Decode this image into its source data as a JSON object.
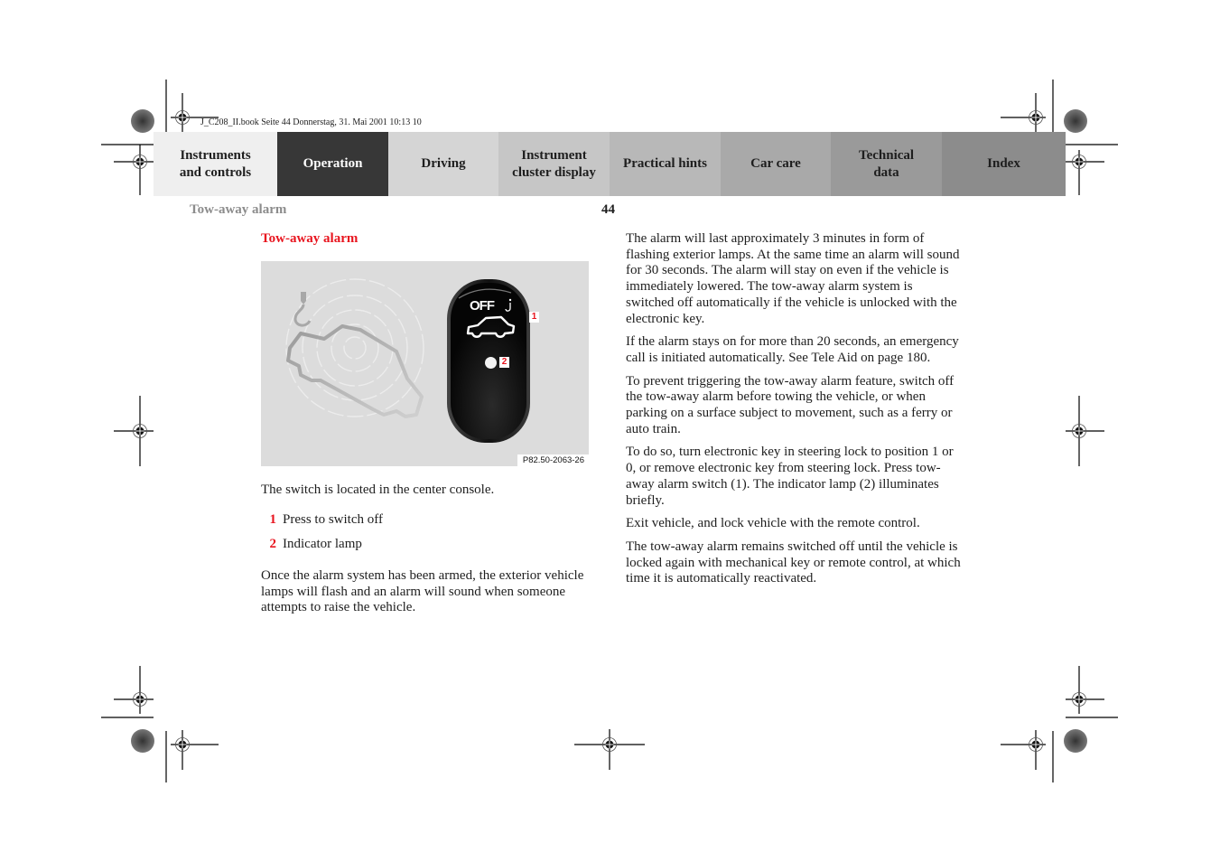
{
  "print_slug": "J_C208_II.book  Seite 44  Donnerstag, 31. Mai 2001  10:13 10",
  "nav": {
    "tabs": [
      {
        "label_line1": "Instruments",
        "label_line2": "and controls",
        "bg": "#efefef",
        "active": false
      },
      {
        "label_line1": "Operation",
        "label_line2": "",
        "bg": "#373737",
        "active": true
      },
      {
        "label_line1": "Driving",
        "label_line2": "",
        "bg": "#d5d5d5",
        "active": false
      },
      {
        "label_line1": "Instrument",
        "label_line2": "cluster display",
        "bg": "#c6c6c6",
        "active": false
      },
      {
        "label_line1": "Practical hints",
        "label_line2": "",
        "bg": "#b8b8b8",
        "active": false
      },
      {
        "label_line1": "Car care",
        "label_line2": "",
        "bg": "#a9a9a9",
        "active": false
      },
      {
        "label_line1": "Technical",
        "label_line2": "data",
        "bg": "#9a9a9a",
        "active": false
      },
      {
        "label_line1": "Index",
        "label_line2": "",
        "bg": "#8c8c8c",
        "active": false
      }
    ]
  },
  "running_header": {
    "title": "Tow-away alarm",
    "page_number": "44"
  },
  "section": {
    "title": "Tow-away alarm",
    "figure": {
      "code": "P82.50-2063-26",
      "switch_label": "OFF",
      "callouts": [
        "1",
        "2"
      ]
    },
    "intro": "The switch is located in the center console.",
    "legend": [
      {
        "num": "1",
        "text": "Press to switch off"
      },
      {
        "num": "2",
        "text": "Indicator lamp"
      }
    ],
    "left_paragraph": "Once the alarm system has been armed, the exterior vehicle lamps will flash and an alarm will sound when someone attempts to raise the vehicle.",
    "right_paragraphs": [
      "The alarm will last approximately 3 minutes in form of flashing exterior lamps. At the same time an alarm will sound for 30 seconds. The alarm will stay on even if the vehicle is immediately lowered. The tow-away alarm system is switched off automatically if the vehicle is unlocked with the electronic key.",
      "If the alarm stays on for more than 20 seconds, an emergency call is initiated automatically. See Tele Aid on page 180.",
      "To prevent triggering the tow-away alarm feature, switch off the tow-away alarm before towing the vehicle, or when parking on a surface subject to movement, such as a ferry or auto train.",
      "To do so, turn electronic key in steering lock to position 1 or 0, or remove electronic key from steering lock. Press tow-away alarm switch (1). The indicator lamp (2) illuminates briefly.",
      "Exit vehicle, and lock vehicle with the remote control.",
      "The tow-away alarm remains switched off until the vehicle is locked again with mechanical key or remote control, at which time it is automatically reactivated."
    ]
  },
  "colors": {
    "accent_red": "#e8141e",
    "running_title_gray": "#8c8c8c",
    "figure_bg": "#dcdcdc"
  }
}
